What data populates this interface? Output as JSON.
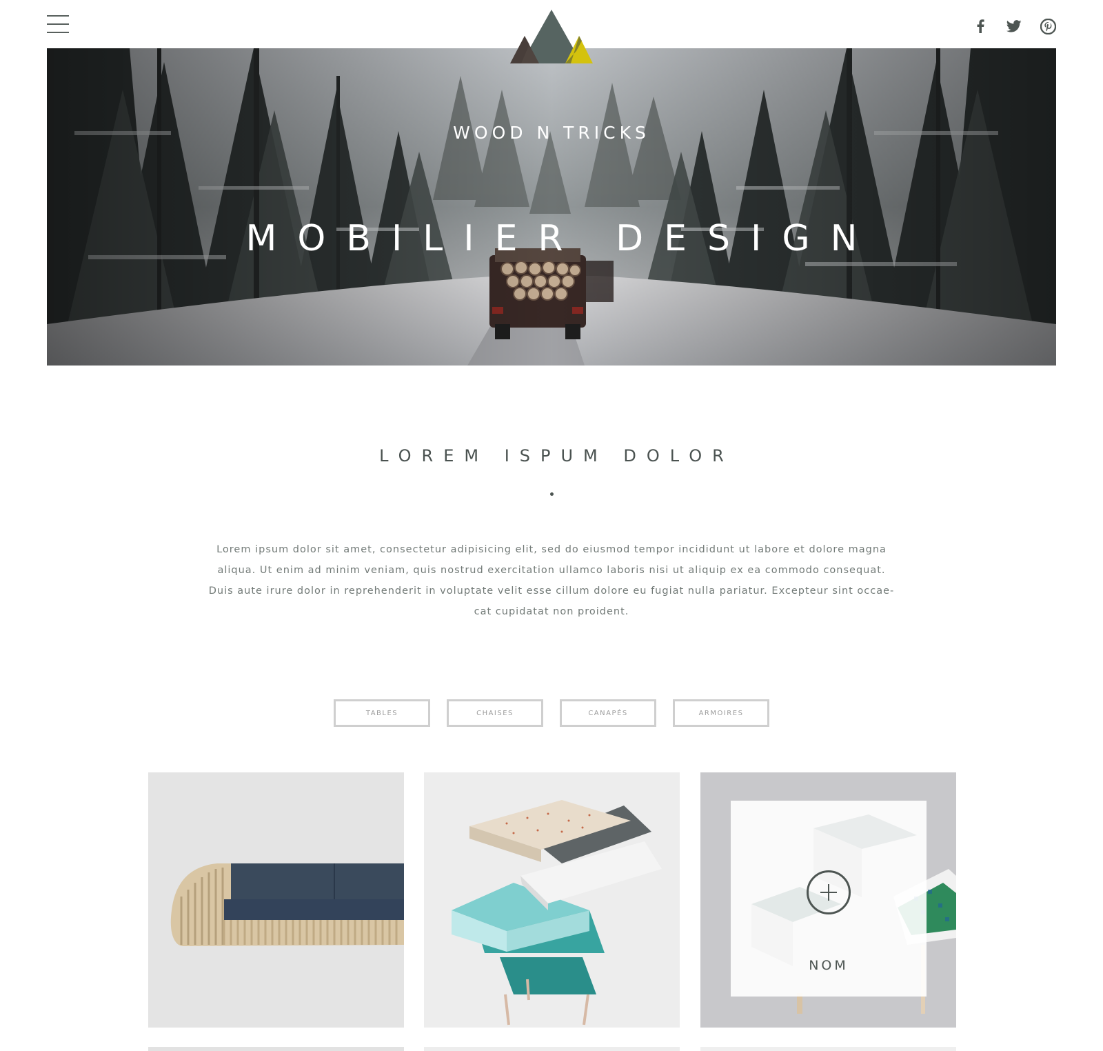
{
  "header": {
    "menu_icon": "hamburger-icon",
    "social": [
      {
        "name": "facebook",
        "icon": "facebook-icon"
      },
      {
        "name": "twitter",
        "icon": "twitter-icon"
      },
      {
        "name": "pinterest",
        "icon": "pinterest-icon"
      }
    ],
    "brand": "WOOD N TRICKS",
    "logo_colors": [
      "#4f4540",
      "#566461",
      "#d4c20e"
    ]
  },
  "hero": {
    "title": "MOBILIER DESIGN"
  },
  "intro": {
    "title": "LOREM ISPUM DOLOR",
    "text": "Lorem ipsum dolor sit amet, consectetur adipisicing elit, sed do eiusmod tempor incididunt ut labore et dolore magna aliqua. Ut enim ad minim veniam, quis nostrud exercitation ullamco laboris nisi ut aliquip ex ea commodo consequat. Duis aute irure dolor in reprehenderit in voluptate velit esse cillum dolore eu fugiat nulla pariatur. Excepteur sint occae-cat cupidatat non proident."
  },
  "filters": {
    "items": [
      "TABLES",
      "CHAISES",
      "CANAPÉS",
      "ARMOIRES"
    ]
  },
  "products": {
    "hover_label": "NOM",
    "hover_icon": "plus-circle-icon"
  }
}
